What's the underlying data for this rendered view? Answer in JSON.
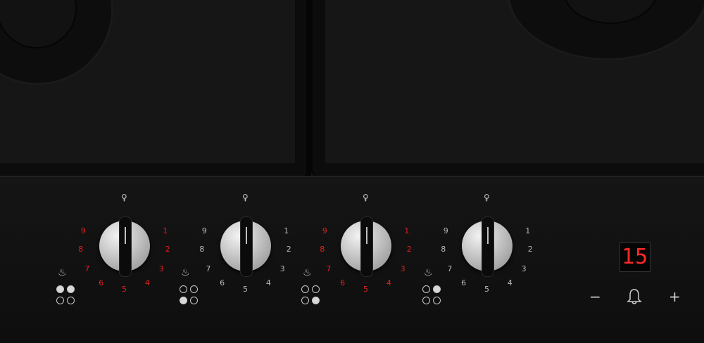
{
  "timer": {
    "value": "15",
    "minus_label": "−",
    "plus_label": "+",
    "bell_icon": "bell-icon"
  },
  "knobs": [
    {
      "name": "knob-1",
      "active": true,
      "zones": [
        "filled",
        "filled",
        "empty",
        "empty"
      ],
      "scale": [
        "1",
        "2",
        "3",
        "4",
        "5",
        "6",
        "7",
        "8",
        "9"
      ]
    },
    {
      "name": "knob-2",
      "active": false,
      "zones": [
        "empty",
        "empty",
        "filled",
        "empty"
      ],
      "scale": [
        "1",
        "2",
        "3",
        "4",
        "5",
        "6",
        "7",
        "8",
        "9"
      ]
    },
    {
      "name": "knob-3",
      "active": true,
      "zones": [
        "empty",
        "empty",
        "empty",
        "filled"
      ],
      "scale": [
        "1",
        "2",
        "3",
        "4",
        "5",
        "6",
        "7",
        "8",
        "9"
      ]
    },
    {
      "name": "knob-4",
      "active": false,
      "zones": [
        "empty",
        "filled",
        "empty",
        "empty"
      ],
      "scale": [
        "1",
        "2",
        "3",
        "4",
        "5",
        "6",
        "7",
        "8",
        "9"
      ]
    }
  ],
  "colors": {
    "active_scale": "#e02020",
    "display_digits": "#ff2828"
  }
}
